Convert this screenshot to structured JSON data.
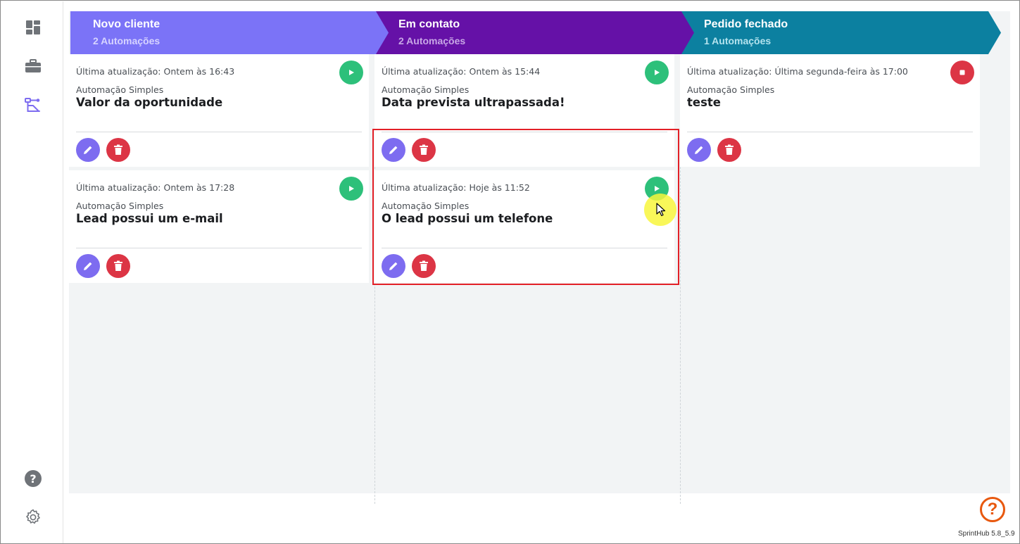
{
  "sidebar": {
    "items": [
      {
        "name": "dashboard",
        "icon": "dashboard-icon"
      },
      {
        "name": "deals",
        "icon": "briefcase-icon"
      },
      {
        "name": "automations",
        "icon": "flow-icon",
        "active": true
      }
    ],
    "bottom": [
      {
        "name": "help",
        "icon": "help-circle-icon"
      },
      {
        "name": "settings",
        "icon": "gear-icon"
      }
    ]
  },
  "columns": [
    {
      "title": "Novo cliente",
      "count": "2 Automações",
      "color": "#7b73f7",
      "count_color": "#d7d4ff",
      "cards": [
        {
          "updated": "Última atualização: Ontem às 16:43",
          "type": "Automação Simples",
          "title": "Valor da oportunidade",
          "status": "play"
        },
        {
          "updated": "Última atualização: Ontem às 17:28",
          "type": "Automação Simples",
          "title": "Lead possui um e-mail",
          "status": "play"
        }
      ]
    },
    {
      "title": "Em contato",
      "count": "2 Automações",
      "color": "#6511a7",
      "count_color": "#c8a7e6",
      "cards": [
        {
          "updated": "Última atualização: Ontem às 15:44",
          "type": "Automação Simples",
          "title": "Data prevista ultrapassada!",
          "status": "play"
        },
        {
          "updated": "Última atualização: Hoje às 11:52",
          "type": "Automação Simples",
          "title": "O lead possui um telefone",
          "status": "play"
        }
      ]
    },
    {
      "title": "Pedido fechado",
      "count": "1 Automações",
      "color": "#0c80a0",
      "count_color": "#b4e3ee",
      "cards": [
        {
          "updated": "Última atualização: Última segunda-feira às 17:00",
          "type": "Automação Simples",
          "title": "teste",
          "status": "stop"
        }
      ]
    }
  ],
  "colors": {
    "play": "#2dc07a",
    "stop": "#dc3545",
    "edit": "#7d6cf0",
    "delete": "#dc3545",
    "help_fab": "#e8580e",
    "highlight": "#e32027"
  },
  "footer": {
    "version": "SprintHub 5.8_5.9",
    "help_symbol": "?"
  }
}
